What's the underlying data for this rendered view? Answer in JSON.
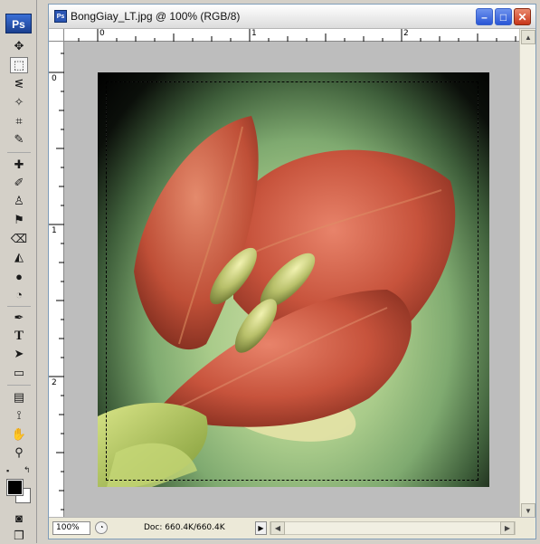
{
  "app": {
    "logo": "Ps"
  },
  "document": {
    "title": "BongGiay_LT.jpg @ 100% (RGB/8)",
    "zoom": "100%",
    "doc_info": "Doc: 660.4K/660.4K"
  },
  "ruler": {
    "top_ticks": [
      "0",
      "1",
      "2"
    ],
    "left_ticks": [
      "0",
      "1",
      "2"
    ]
  },
  "tools": [
    "move-tool",
    "rectangular-marquee-tool",
    "lasso-tool",
    "magic-wand-tool",
    "crop-tool",
    "slice-tool",
    "healing-brush-tool",
    "brush-tool",
    "clone-stamp-tool",
    "history-brush-tool",
    "eraser-tool",
    "paint-bucket-tool",
    "blur-tool",
    "dodge-tool",
    "pen-tool",
    "type-tool",
    "path-selection-tool",
    "rectangle-tool",
    "notes-tool",
    "eyedropper-tool",
    "hand-tool",
    "zoom-tool"
  ],
  "tool_glyphs": [
    "✥",
    "⬚",
    "ᓬ",
    "✧",
    "⌗",
    "✎",
    "✚",
    "✐",
    "♙",
    "⚑",
    "⌫",
    "◭",
    "●",
    "◔",
    "✒",
    "T",
    "➤",
    "▭",
    "▤",
    "⟟",
    "✋",
    "⚲"
  ],
  "colors": {
    "foreground": "#000000",
    "background": "#ffffff"
  }
}
